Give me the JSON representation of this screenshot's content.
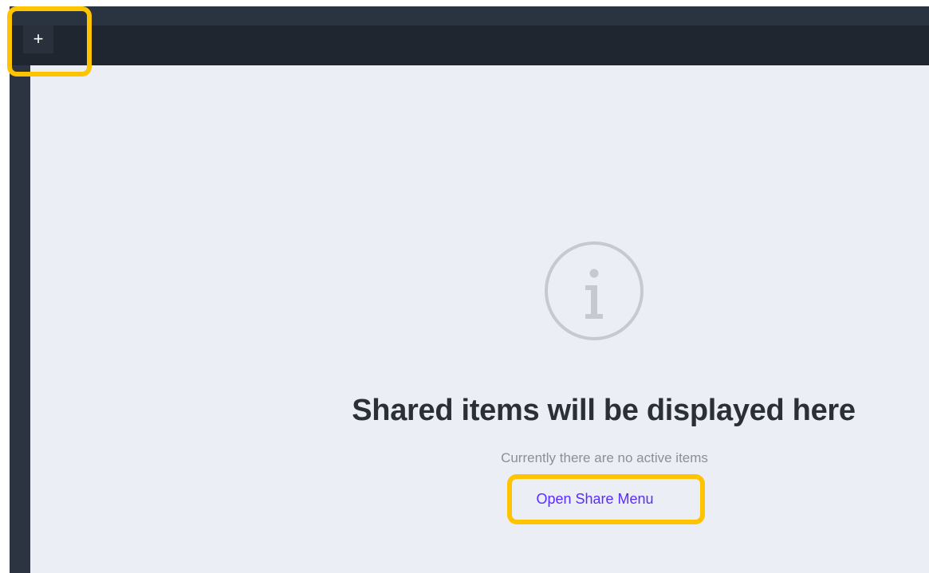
{
  "toolbar": {
    "add_label": "+"
  },
  "empty_state": {
    "icon": "info-icon",
    "title": "Shared items will be displayed here",
    "subtitle": "Currently there are no active items",
    "action_label": "Open Share Menu"
  },
  "colors": {
    "highlight": "#ffc400",
    "link": "#5a2bff",
    "frame_dark": "#1f2630",
    "content_bg": "#eceef5"
  }
}
